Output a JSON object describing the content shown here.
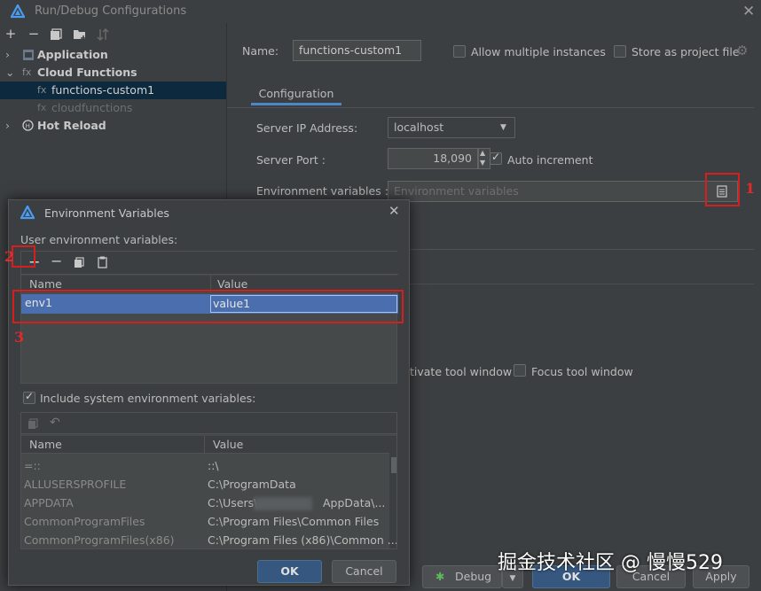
{
  "window": {
    "title": "Run/Debug Configurations"
  },
  "toolbar": {
    "icons": [
      "add-icon",
      "remove-icon",
      "copy-icon",
      "folder-add-icon",
      "sort-icon"
    ]
  },
  "tree": {
    "application": "Application",
    "cloud_functions": "Cloud Functions",
    "functions_custom1": "functions-custom1",
    "cloudfunctions": "cloudfunctions",
    "hot_reload": "Hot Reload"
  },
  "config": {
    "name_label": "Name:",
    "name_value": "functions-custom1",
    "allow_multiple": "Allow multiple instances",
    "store_project": "Store as project file",
    "tab_configuration": "Configuration",
    "server_ip_label": "Server IP Address:",
    "server_ip_value": "localhost",
    "server_port_label": "Server Port :",
    "server_port_value": "18,090",
    "auto_increment": "Auto increment",
    "env_label": "Environment variables :",
    "env_placeholder": "Environment variables",
    "activate_tool_window": "tivate tool window",
    "focus_tool_window": "Focus tool window",
    "debug_button": "Debug",
    "ok_button": "OK",
    "cancel_button": "Cancel",
    "apply_button": "Apply"
  },
  "dialog": {
    "title": "Environment Variables",
    "user_env_label": "User environment variables:",
    "col_name": "Name",
    "col_value": "Value",
    "user_rows": [
      {
        "name": "env1",
        "value": "value1"
      }
    ],
    "include_system": "Include system environment variables:",
    "sys_col_name": "Name",
    "sys_col_value": "Value",
    "sys_rows": [
      {
        "name": "=::",
        "value": "::\\"
      },
      {
        "name": "ALLUSERSPROFILE",
        "value": "C:\\ProgramData"
      },
      {
        "name": "APPDATA",
        "value": "C:\\Users\\",
        "value_tail": "AppData\\..."
      },
      {
        "name": "CommonProgramFiles",
        "value": "C:\\Program Files\\Common Files"
      },
      {
        "name": "CommonProgramFiles(x86)",
        "value": "C:\\Program Files (x86)\\Common ..."
      }
    ],
    "ok": "OK",
    "cancel": "Cancel"
  },
  "annotations": {
    "n1": "1",
    "n2": "2",
    "n3": "3"
  },
  "watermark": "掘金技术社区 @ 慢慢529",
  "colors": {
    "accent": "#4a88c7",
    "selection": "#4b6eaf",
    "highlight_box": "#d51f1f"
  }
}
